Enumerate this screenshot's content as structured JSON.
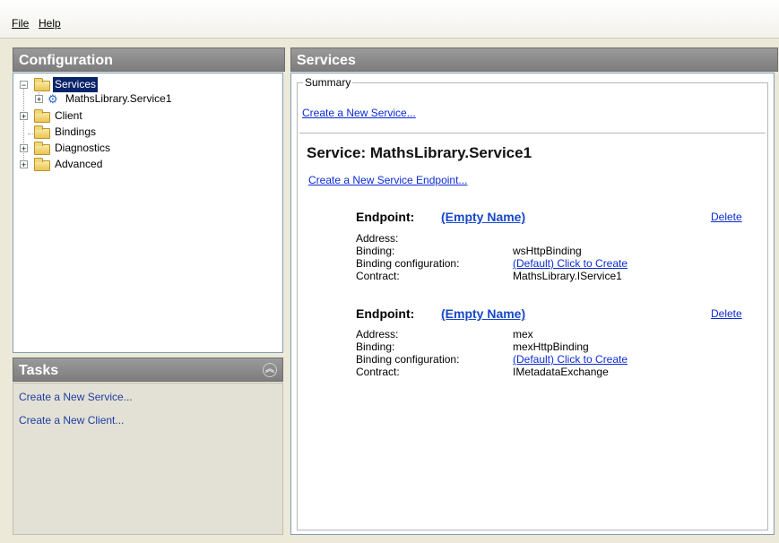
{
  "menu": {
    "file": "File",
    "help": "Help"
  },
  "left": {
    "header": "Configuration",
    "tree": {
      "services": "Services",
      "service1": "MathsLibrary.Service1",
      "client": "Client",
      "bindings": "Bindings",
      "diagnostics": "Diagnostics",
      "advanced": "Advanced"
    }
  },
  "tasks": {
    "header": "Tasks",
    "items": [
      "Create a New Service...",
      "Create a New Client..."
    ]
  },
  "right": {
    "header": "Services",
    "summary_label": "Summary",
    "create_service_link": "Create a New Service...",
    "service_title": "Service: MathsLibrary.Service1",
    "create_endpoint_link": "Create a New Service Endpoint...",
    "endpoints": [
      {
        "label": "Endpoint:",
        "name": "(Empty Name)",
        "delete": "Delete",
        "address_label": "Address:",
        "address": "",
        "binding_label": "Binding:",
        "binding": "wsHttpBinding",
        "binding_config_label": "Binding configuration:",
        "binding_config": "(Default) Click to Create",
        "contract_label": "Contract:",
        "contract": "MathsLibrary.IService1"
      },
      {
        "label": "Endpoint:",
        "name": "(Empty Name)",
        "delete": "Delete",
        "address_label": "Address:",
        "address": "mex",
        "binding_label": "Binding:",
        "binding": "mexHttpBinding",
        "binding_config_label": "Binding configuration:",
        "binding_config": "(Default) Click to Create",
        "contract_label": "Contract:",
        "contract": "IMetadataExchange"
      }
    ]
  }
}
